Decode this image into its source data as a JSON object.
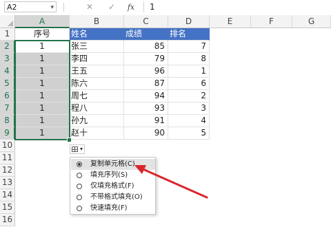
{
  "formula_bar": {
    "name_box": "A2",
    "cancel_glyph": "✕",
    "enter_glyph": "✓",
    "fx_label": "fx",
    "formula_value": "1"
  },
  "columns": [
    "A",
    "B",
    "C",
    "D",
    "E",
    "F",
    "G"
  ],
  "rows": [
    "1",
    "2",
    "3",
    "4",
    "5",
    "6",
    "7",
    "8",
    "9",
    "10",
    "11",
    "12",
    "13",
    "14",
    "15",
    "16"
  ],
  "table": {
    "headers": [
      "序号",
      "姓名",
      "成绩",
      "排名"
    ],
    "records": [
      {
        "seq": "1",
        "name": "张三",
        "score": "85",
        "rank": "7"
      },
      {
        "seq": "1",
        "name": "李四",
        "score": "79",
        "rank": "8"
      },
      {
        "seq": "1",
        "name": "王五",
        "score": "96",
        "rank": "1"
      },
      {
        "seq": "1",
        "name": "陈六",
        "score": "87",
        "rank": "6"
      },
      {
        "seq": "1",
        "name": "周七",
        "score": "94",
        "rank": "2"
      },
      {
        "seq": "1",
        "name": "程八",
        "score": "93",
        "rank": "3"
      },
      {
        "seq": "1",
        "name": "孙九",
        "score": "91",
        "rank": "4"
      },
      {
        "seq": "1",
        "name": "赵十",
        "score": "90",
        "rank": "5"
      }
    ]
  },
  "autofill_menu": {
    "items": [
      {
        "label": "复制单元格(C)",
        "selected": true
      },
      {
        "label": "填充序列(S)",
        "selected": false
      },
      {
        "label": "仅填充格式(F)",
        "selected": false
      },
      {
        "label": "不带格式填充(O)",
        "selected": false
      },
      {
        "label": "快速填充(F)",
        "selected": false
      }
    ]
  },
  "colors": {
    "accent_green": "#217346",
    "header_blue": "#4472c4",
    "arrow_red": "#d9262b"
  },
  "icons": {
    "autofill": "autofill-options-icon",
    "arrow": "red-annotation-arrow"
  }
}
